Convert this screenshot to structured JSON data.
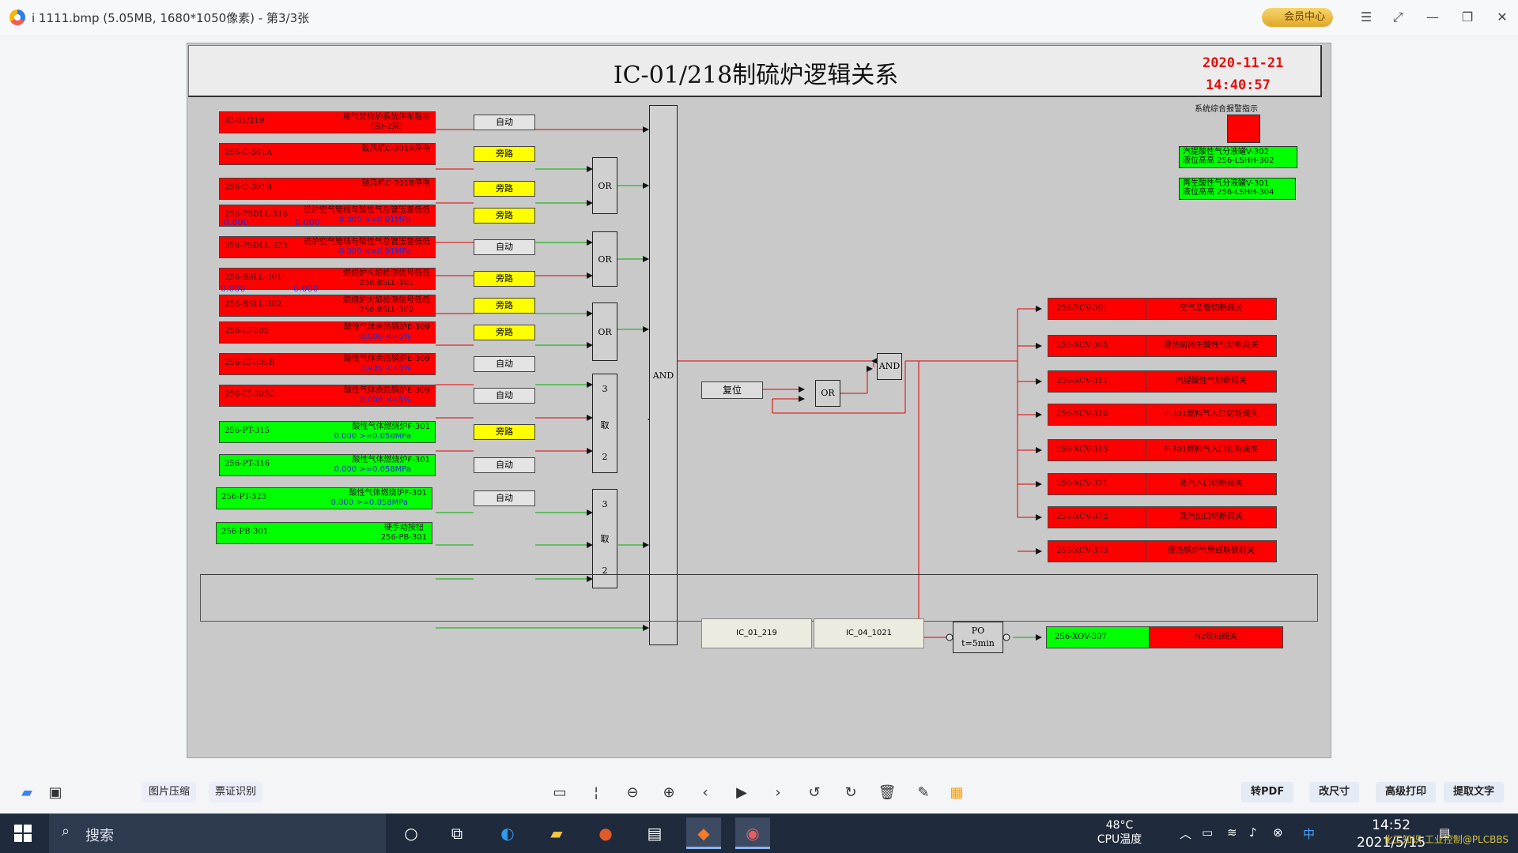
{
  "window": {
    "title": "i 1111.bmp (5.05MB, 1680*1050像素) - 第3/3张",
    "vip_label": "会员中心"
  },
  "hmi": {
    "title": "IC-01/218制硫炉逻辑关系",
    "date": "2020-11-21",
    "time": "14:40:57",
    "alarm_label": "系统综合报警指示",
    "levels": [
      {
        "line1": "汽提酸性气分液罐V-302",
        "line2": "液位高高   256-LSHH-302"
      },
      {
        "line1": "再生酸性气分液罐V-301",
        "line2": "液位高高   256-LSHH-304"
      }
    ],
    "inputs": [
      {
        "tag": "IC-01/219",
        "desc": "尾气焚烧炉系统停车指示",
        "desc2": "(自I-2来)",
        "value": "",
        "bypass": "自动"
      },
      {
        "tag": "256-C-301A",
        "desc": "鼓风机C-301A停电",
        "desc2": "",
        "value": "",
        "bypass": "旁路"
      },
      {
        "tag": "256-C-301B",
        "desc": "鼓风机C-301B停电",
        "desc2": "",
        "value": "",
        "bypass": "旁路"
      },
      {
        "tag": "256-PSDLL-316",
        "desc": "进炉空气管线与酸性气总管压差低低",
        "desc2": "",
        "value": "0.000 <=0.01MPa",
        "bypass": "旁路"
      },
      {
        "tag": "256-PSDLL-323",
        "desc": "进炉空气管线与酸性气总管压差低低",
        "desc2": "",
        "value": "-0.000 <=0.01MPa",
        "bypass": "自动"
      },
      {
        "tag": "256-BSLL-301",
        "desc": "燃烧炉火焰检测信号低低",
        "desc2": "256-BSLL-301",
        "value": "",
        "bypass": "旁路"
      },
      {
        "tag": "256-BSLL-302",
        "desc": "燃烧炉火焰检测信号低低",
        "desc2": "256-BSLL-302",
        "value": "",
        "bypass": "旁路"
      },
      {
        "tag": "256-LT-305",
        "desc": "酸性气体余热锅炉E-309",
        "desc2": "",
        "value": "0.000 <=5%",
        "bypass": "旁路"
      },
      {
        "tag": "256-LT-305B",
        "desc": "酸性气体余热锅炉E-309",
        "desc2": "",
        "value": "3.439 <=5%",
        "bypass": "自动"
      },
      {
        "tag": "256-LT-305C",
        "desc": "酸性气体余热锅炉E-309",
        "desc2": "",
        "value": "0.000 <=5%",
        "bypass": "自动"
      },
      {
        "tag": "256-PT-315",
        "desc": "酸性气体燃烧炉F-301",
        "desc2": "",
        "value": "0.000 >=0.058MPa",
        "bypass": "旁路"
      },
      {
        "tag": "256-PT-316",
        "desc": "酸性气体燃烧炉F-301",
        "desc2": "",
        "value": "0.000 >=0.058MPa",
        "bypass": "自动"
      },
      {
        "tag": "256-PT-323",
        "desc": "酸性气体燃烧炉F-301",
        "desc2": "",
        "value": "0.000 >=0.058MPa",
        "bypass": "自动"
      },
      {
        "tag": "256-PB-301",
        "desc": "硬手动按钮",
        "desc2": "256-PB-301",
        "value": "",
        "bypass": ""
      }
    ],
    "top_values": [
      {
        "a": "0.000",
        "b": "0.000"
      },
      {
        "a": "0.000",
        "b": "0.000"
      }
    ],
    "gates": {
      "or1": "OR",
      "or2": "OR",
      "or3": "OR",
      "vote1": [
        "3",
        "取",
        "2"
      ],
      "vote2": [
        "3",
        "取",
        "2"
      ],
      "and_main": "AND",
      "or_reset": "OR",
      "and_out": "AND",
      "timer_line1": "PO",
      "timer_line2": "t=5min"
    },
    "reset_label": "复位",
    "outputs": [
      {
        "tag": "256-XCV-301",
        "desc": "空气总管切断阀关"
      },
      {
        "tag": "256-XCV-305",
        "desc": "提热前再生酸性气切断阀关"
      },
      {
        "tag": "256-XCV-311",
        "desc": "汽提酸性气切断阀关"
      },
      {
        "tag": "256-XCV-310",
        "desc": "F-301燃料气入口切断阀关"
      },
      {
        "tag": "256-XCV-313",
        "desc": "F-301燃料气入口切断阀关"
      },
      {
        "tag": "256-XCV-371",
        "desc": "蒸汽入口切断阀关"
      },
      {
        "tag": "256-XCV-372",
        "desc": "蒸汽出口切断阀关"
      },
      {
        "tag": "256-XCV-373",
        "desc": "废热锅炉气管线联锁阀关"
      }
    ],
    "n2_output": {
      "tag": "256-XOV-307",
      "desc": "N2吹扫阀关"
    },
    "nav": [
      "IC_01_219",
      "IC_04_1021"
    ]
  },
  "toolbar": {
    "left": [
      "图片压缩",
      "票证识别"
    ],
    "right": [
      "转PDF",
      "改尺寸",
      "高级打印",
      "提取文字"
    ]
  },
  "taskbar": {
    "search_placeholder": "搜索",
    "temp": "48°C",
    "temp_label": "CPU温度",
    "time": "14:52",
    "date": "2021/5/15",
    "watermark": "化工知识·工业控制@PLCBBS"
  },
  "colors": {
    "alarm_red": "#ff0000",
    "normal_green": "#00ff00",
    "bypass_yellow": "#ffff00",
    "hmi_bg": "#c9c9c9"
  }
}
